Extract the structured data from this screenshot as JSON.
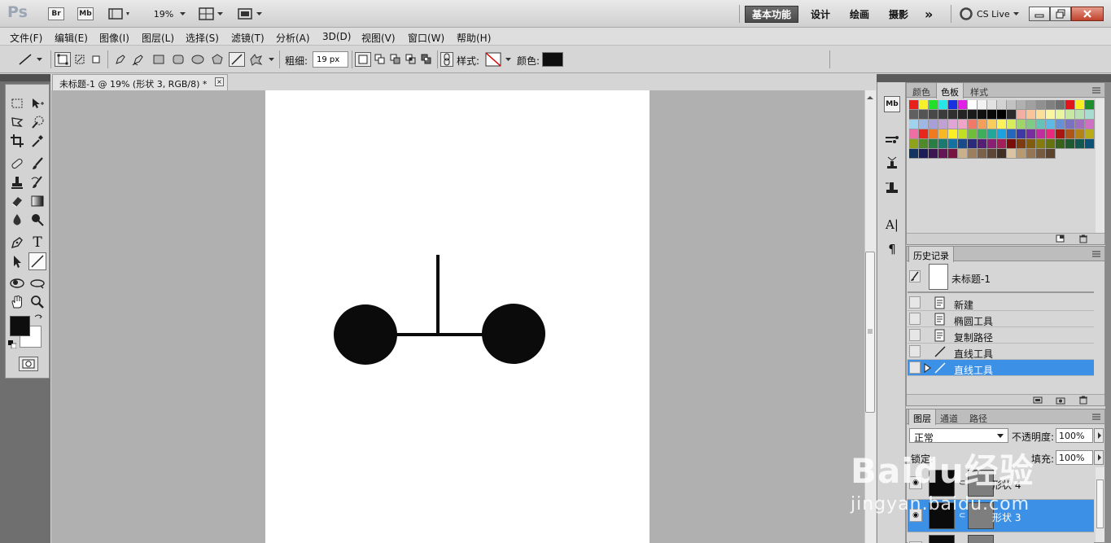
{
  "app_bar": {
    "logo": "Ps",
    "bridge": "Br",
    "minibridge": "Mb",
    "zoom": "19%",
    "workspaces": [
      "基本功能",
      "设计",
      "绘画",
      "摄影"
    ],
    "more": "»",
    "cs_live": "CS Live"
  },
  "menu": [
    "文件(F)",
    "编辑(E)",
    "图像(I)",
    "图层(L)",
    "选择(S)",
    "滤镜(T)",
    "分析(A)",
    "3D(D)",
    "视图(V)",
    "窗口(W)",
    "帮助(H)"
  ],
  "options": {
    "weight_label": "粗细:",
    "weight_value": "19 px",
    "style_label": "样式:",
    "color_label": "颜色:",
    "color_value": "#111111"
  },
  "document": {
    "tab_title": "未标题-1 @ 19% (形状 3, RGB/8) *",
    "close": "×"
  },
  "swatch_panel": {
    "tabs": [
      "颜色",
      "色板",
      "样式"
    ],
    "active_tab": "色板"
  },
  "history_panel": {
    "tab": "历史记录",
    "snapshot": "未标题-1",
    "items": [
      "新建",
      "椭圆工具",
      "复制路径",
      "直线工具",
      "直线工具"
    ]
  },
  "layers_panel": {
    "tabs": [
      "图层",
      "通道",
      "路径"
    ],
    "blend_mode": "正常",
    "opacity_label": "不透明度:",
    "opacity_value": "100%",
    "lock_label": "锁定:",
    "fill_label": "填充:",
    "fill_value": "100%",
    "layers": [
      "形状 4",
      "形状 3",
      ""
    ]
  },
  "watermark": {
    "line1": "Baidu经验",
    "line2": "jingyan.baidu.com"
  }
}
